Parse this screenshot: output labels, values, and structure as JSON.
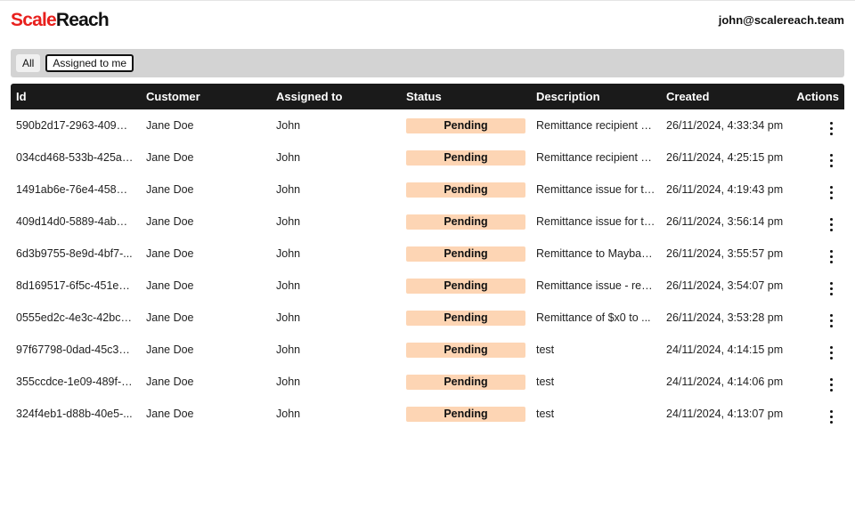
{
  "colors": {
    "accent": "#e8201d",
    "badge": "#fdd5b4"
  },
  "header": {
    "logo_part1": "Scale",
    "logo_part2": "Reach",
    "user_email": "john@scalereach.team"
  },
  "filters": [
    {
      "label": "All",
      "active": false
    },
    {
      "label": "Assigned to me",
      "active": true
    }
  ],
  "table": {
    "columns": [
      "Id",
      "Customer",
      "Assigned to",
      "Status",
      "Description",
      "Created",
      "Actions"
    ],
    "rows": [
      {
        "id": "590b2d17-2963-4097-...",
        "customer": "Jane Doe",
        "assigned": "John",
        "status": "Pending",
        "description": "Remittance recipient cl...",
        "created": "26/11/2024, 4:33:34 pm",
        "actions_icon": "kebab-menu-icon"
      },
      {
        "id": "034cd468-533b-425a-...",
        "customer": "Jane Doe",
        "assigned": "John",
        "status": "Pending",
        "description": "Remittance recipient cl...",
        "created": "26/11/2024, 4:25:15 pm",
        "actions_icon": "kebab-menu-icon"
      },
      {
        "id": "1491ab6e-76e4-4580-...",
        "customer": "Jane Doe",
        "assigned": "John",
        "status": "Pending",
        "description": "Remittance issue for tr...",
        "created": "26/11/2024, 4:19:43 pm",
        "actions_icon": "kebab-menu-icon"
      },
      {
        "id": "409d14d0-5889-4ab8-...",
        "customer": "Jane Doe",
        "assigned": "John",
        "status": "Pending",
        "description": "Remittance issue for tr...",
        "created": "26/11/2024, 3:56:14 pm",
        "actions_icon": "kebab-menu-icon"
      },
      {
        "id": "6d3b9755-8e9d-4bf7-...",
        "customer": "Jane Doe",
        "assigned": "John",
        "status": "Pending",
        "description": "Remittance to Mayban...",
        "created": "26/11/2024, 3:55:57 pm",
        "actions_icon": "kebab-menu-icon"
      },
      {
        "id": "8d169517-6f5c-451e-a...",
        "customer": "Jane Doe",
        "assigned": "John",
        "status": "Pending",
        "description": "Remittance issue - rec...",
        "created": "26/11/2024, 3:54:07 pm",
        "actions_icon": "kebab-menu-icon"
      },
      {
        "id": "0555ed2c-4e3c-42bc-...",
        "customer": "Jane Doe",
        "assigned": "John",
        "status": "Pending",
        "description": "Remittance of $x0 to ...",
        "created": "26/11/2024, 3:53:28 pm",
        "actions_icon": "kebab-menu-icon"
      },
      {
        "id": "97f67798-0dad-45c3-a...",
        "customer": "Jane Doe",
        "assigned": "John",
        "status": "Pending",
        "description": "test",
        "created": "24/11/2024, 4:14:15 pm",
        "actions_icon": "kebab-menu-icon"
      },
      {
        "id": "355ccdce-1e09-489f-9...",
        "customer": "Jane Doe",
        "assigned": "John",
        "status": "Pending",
        "description": "test",
        "created": "24/11/2024, 4:14:06 pm",
        "actions_icon": "kebab-menu-icon"
      },
      {
        "id": "324f4eb1-d88b-40e5-...",
        "customer": "Jane Doe",
        "assigned": "John",
        "status": "Pending",
        "description": "test",
        "created": "24/11/2024, 4:13:07 pm",
        "actions_icon": "kebab-menu-icon"
      }
    ]
  }
}
